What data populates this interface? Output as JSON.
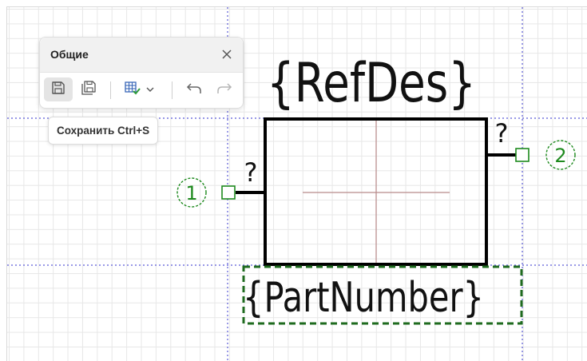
{
  "panel": {
    "title": "Общие",
    "close_icon": "close-icon",
    "tools": [
      {
        "name": "save",
        "icon": "save-icon",
        "active": true
      },
      {
        "name": "save-as",
        "icon": "save-as-icon"
      },
      {
        "name": "table",
        "icon": "table-check-icon",
        "dropdown": true
      },
      {
        "name": "undo",
        "icon": "undo-icon"
      },
      {
        "name": "redo",
        "icon": "redo-icon",
        "disabled": true
      }
    ]
  },
  "tooltip": {
    "text": "Сохранить Ctrl+S"
  },
  "symbol": {
    "refdes": "{RefDes}",
    "part_number": "{PartNumber}",
    "pin_1": {
      "number": "1",
      "name": "?"
    },
    "pin_2": {
      "number": "2",
      "name": "?"
    }
  },
  "colors": {
    "grid": "#e7e7e7",
    "guide": "#5b5bd6",
    "body": "#000000",
    "pin_marker": "#1e8a1e",
    "selection": "#1f6b1f",
    "origin_cross": "#b88a8a"
  }
}
